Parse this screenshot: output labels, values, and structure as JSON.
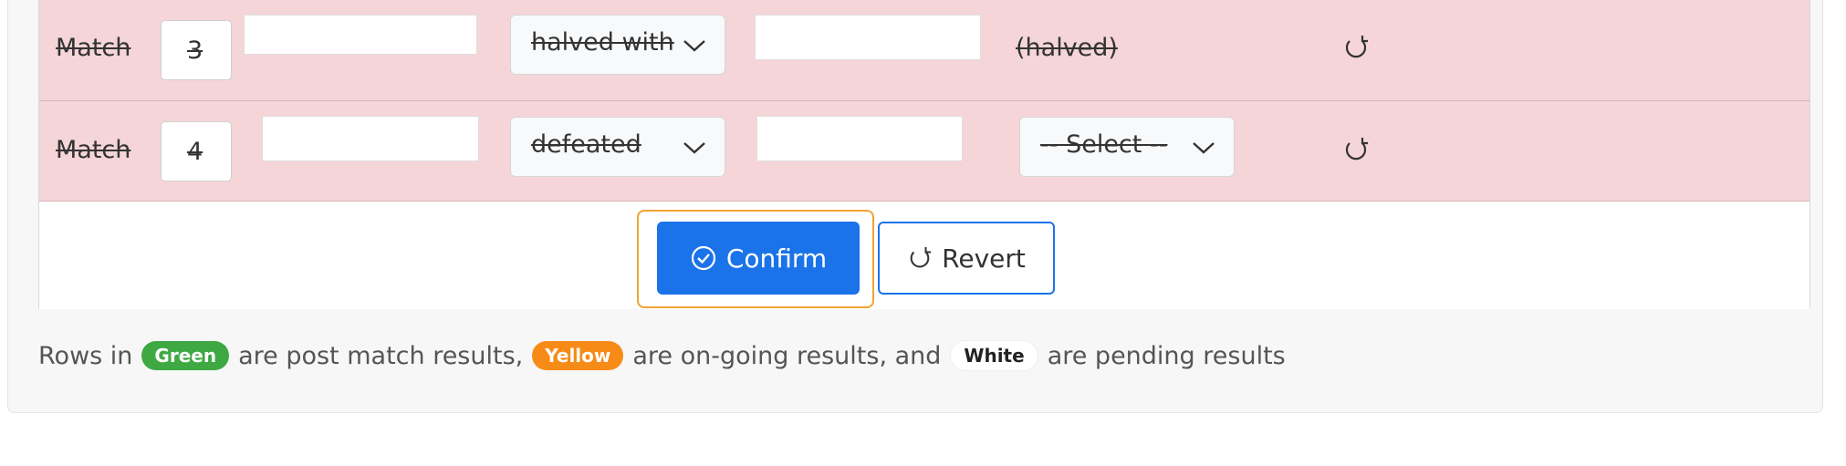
{
  "rows": [
    {
      "label": "Match",
      "number": "3",
      "result_select": "halved with",
      "outcome_text": "(halved)"
    },
    {
      "label": "Match",
      "number": "4",
      "result_select": "defeated",
      "outcome_select": "-- Select --"
    }
  ],
  "actions": {
    "confirm_label": "Confirm",
    "revert_label": "Revert"
  },
  "legend": {
    "prefix": "Rows in",
    "green_label": "Green",
    "after_green": "are post match results,",
    "yellow_label": "Yellow",
    "after_yellow": "are on-going results, and",
    "white_label": "White",
    "after_white": "are pending results"
  },
  "colors": {
    "row_background": "#f5d5d8",
    "primary": "#1a73e8",
    "focus_ring": "#f0a431",
    "green_badge": "#3ea843",
    "yellow_badge": "#f78b17"
  },
  "icons": {
    "row_action": "refresh-icon",
    "confirm": "check-circle-icon",
    "revert": "refresh-icon",
    "dropdown": "chevron-down-icon"
  }
}
